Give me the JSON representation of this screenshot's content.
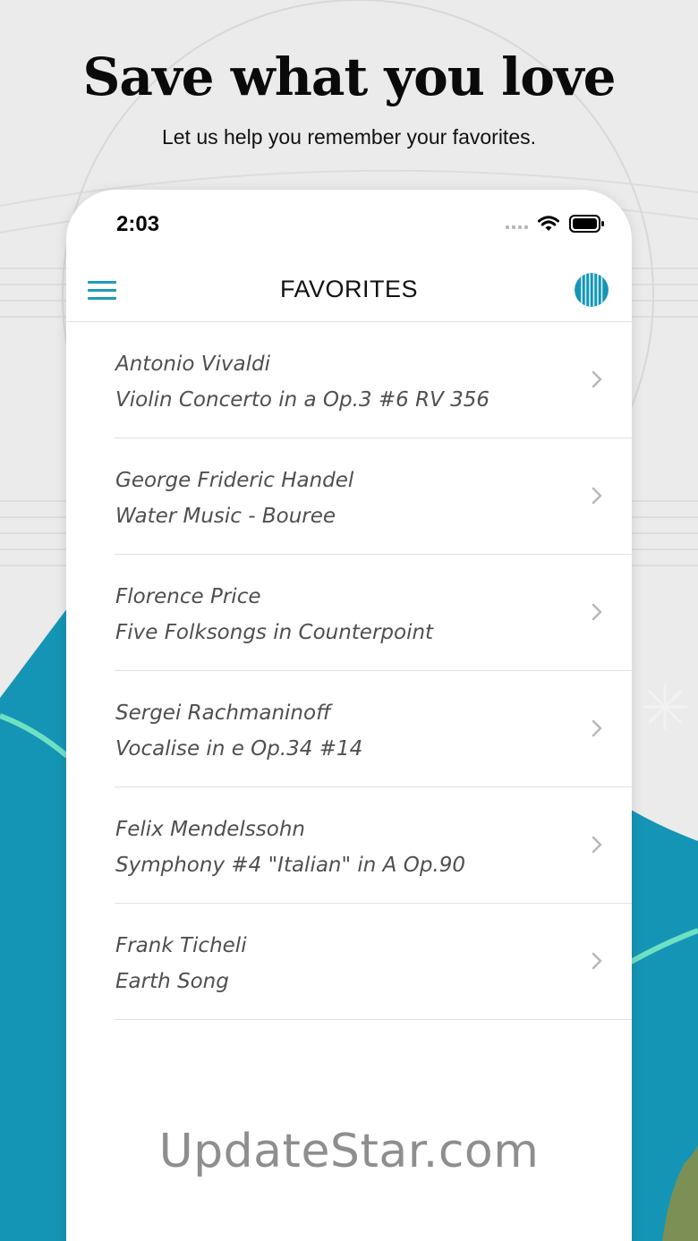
{
  "promo": {
    "headline": "Save what you love",
    "subheadline": "Let us help you remember your favorites."
  },
  "status_bar": {
    "time": "2:03"
  },
  "nav": {
    "title": "FAVORITES",
    "menu_icon": "hamburger-menu-icon",
    "profile_icon": "striped-circle-avatar"
  },
  "favorites": [
    {
      "composer": "Antonio Vivaldi",
      "title": "Violin Concerto in a Op.3 #6 RV 356"
    },
    {
      "composer": "George Frideric Handel",
      "title": "Water Music - Bouree"
    },
    {
      "composer": "Florence Price",
      "title": "Five Folksongs in Counterpoint"
    },
    {
      "composer": "Sergei Rachmaninoff",
      "title": "Vocalise in e Op.34 #14"
    },
    {
      "composer": "Felix Mendelssohn",
      "title": "Symphony #4  \"Italian\" in A Op.90"
    },
    {
      "composer": "Frank Ticheli",
      "title": "Earth Song"
    }
  ],
  "watermark": "UpdateStar.com",
  "colors": {
    "accent": "#1f9bb8",
    "teal_background": "#1595b5",
    "mint_line": "#6fe0c4",
    "page_background": "#ebebeb"
  }
}
